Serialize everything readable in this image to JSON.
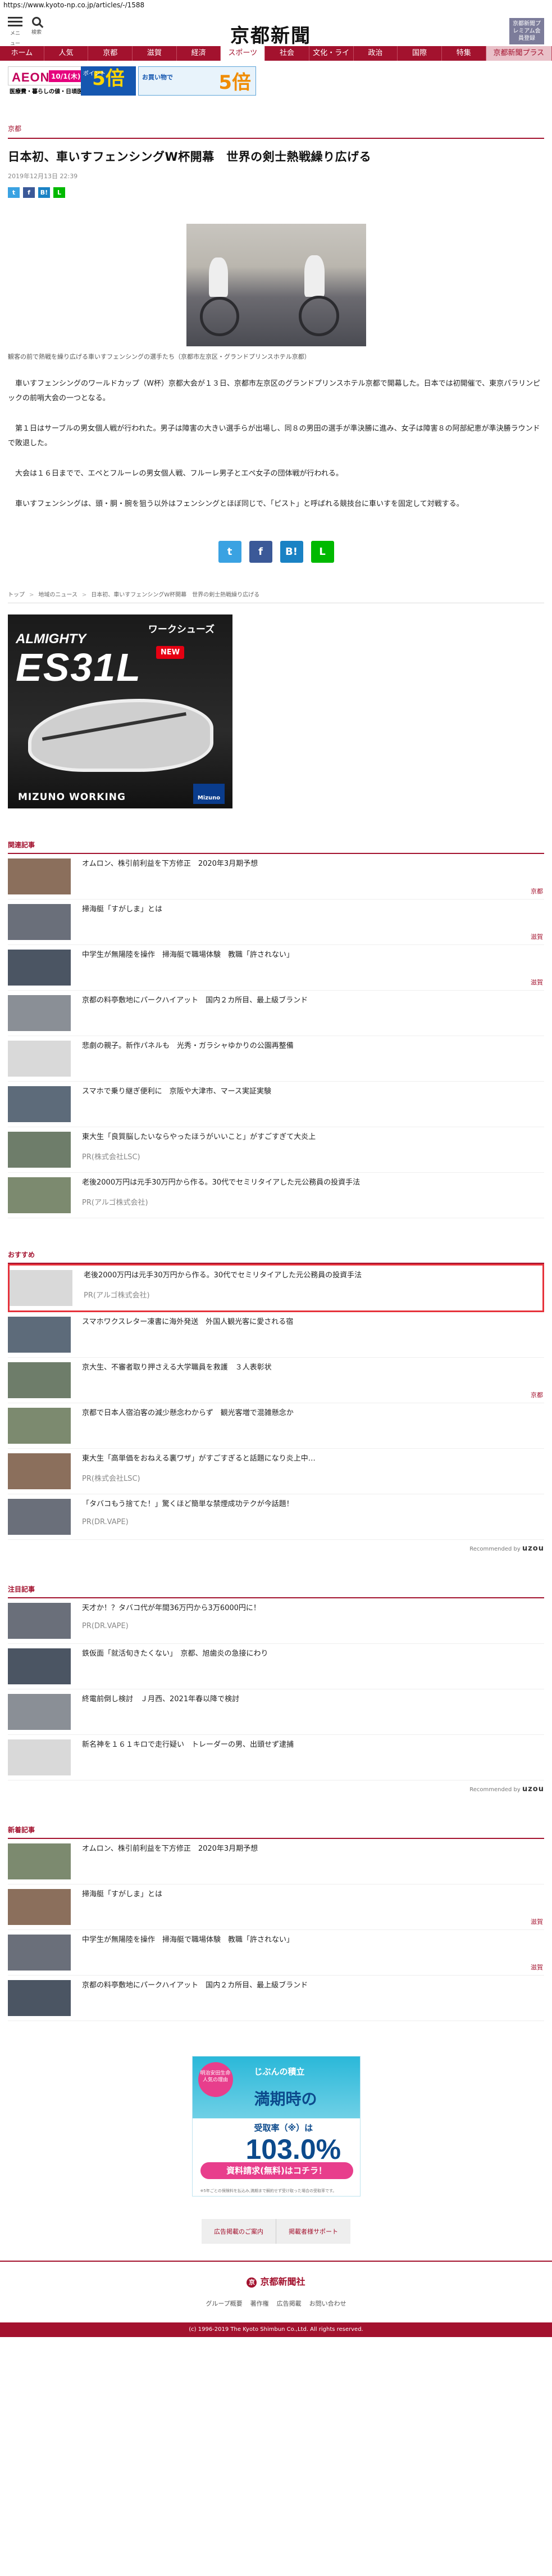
{
  "browser": {
    "url": "https://www.kyoto-np.co.jp/articles/-/1588"
  },
  "header": {
    "menu_label": "メニュー",
    "search_label": "検索",
    "logo": "京都新聞",
    "premium_label": "京都新聞プレミアム会員登録"
  },
  "nav": {
    "items": [
      "ホーム",
      "人気",
      "京都",
      "滋賀",
      "経済",
      "スポーツ",
      "社会",
      "文化・ライフ",
      "政治",
      "国際",
      "特集",
      "京都新聞プラス"
    ],
    "active_index": 5
  },
  "banner": {
    "brand": "AEON",
    "dates": "10/1(木)~10/30(金)",
    "text": "医療費・暮らしの値・日頃医療費が増額",
    "points1": "5倍",
    "points1_note": "ポイント",
    "points2": "5倍",
    "points2_note": "お買い物で"
  },
  "article": {
    "category": "京都",
    "title": "日本初、車いすフェンシングW杯開幕　世界の剣士熱戦繰り広げる",
    "date": "2019年12月13日 22:39",
    "caption": "観客の前で熱戦を繰り広げる車いすフェンシングの選手たち（京都市左京区・グランドプリンスホテル京都）",
    "paragraphs": [
      "車いすフェンシングのワールドカップ（W杯）京都大会が１３日、京都市左京区のグランドプリンスホテル京都で開幕した。日本では初開催で、東京パラリンピックの前哨大会の一つとなる。",
      "第１日はサーブルの男女個人戦が行われた。男子は障害の大きい選手らが出場し、同８の男田の選手が準決勝に進み、女子は障害８の阿部紀恵が準決勝ラウンドで敗退した。",
      "大会は１６日までで、エペとフルーレの男女個人戦、フルーレ男子とエペ女子の団体戦が行われる。",
      "車いすフェンシングは、頭・胴・腕を狙う以外はフェンシングとほぼ同じで、「ピスト」と呼ばれる競技台に車いすを固定して対戦する。"
    ]
  },
  "share": {
    "twitter": "t",
    "facebook": "f",
    "hatena": "B!",
    "line": "L"
  },
  "breadcrumb": [
    "トップ",
    "地域のニュース",
    "日本初、車いすフェンシングW杯開幕　世界の剣士熱戦繰り広げる"
  ],
  "ad1": {
    "series": "ワークシューズ",
    "brand_top": "ALMIGHTY",
    "model": "ES31L",
    "badge": "NEW",
    "footer": "MIZUNO WORKING",
    "maker": "Mizuno"
  },
  "related": {
    "heading": "関連記事",
    "items": [
      {
        "title": "オムロン、株引前利益を下方修正　2020年3月期予想",
        "tag": "京都"
      },
      {
        "title": "掃海艇「すがしま」とは",
        "tag": "滋賀"
      },
      {
        "title": "中学生が無陽陸を操作　掃海艇で職場体験　教職「許されない」",
        "tag": "滋賀"
      },
      {
        "title": "京都の料亭敷地にパークハイアット　国内２カ所目、最上級ブランド",
        "tag": ""
      },
      {
        "title": "悲劇の親子。新作パネルも　光秀・ガラシャゆかりの公園再整備",
        "tag": ""
      },
      {
        "title": "スマホで乗り継ぎ便利に　京阪や大津市、マース実証実験",
        "tag": ""
      },
      {
        "title": "東大生「良質脳したいならやったほうがいいこと」がすごすぎて大炎上",
        "pr": "PR(株式会社LSC)"
      },
      {
        "title": "老後2000万円は元手30万円から作る。30代でセミリタイアした元公務員の投資手法",
        "pr": "PR(アルゴ株式会社)"
      }
    ]
  },
  "recommended": {
    "heading": "おすすめ",
    "items": [
      {
        "title": "老後2000万円は元手30万円から作る。30代でセミリタイアした元公務員の投資手法",
        "pr": "PR(アルゴ株式会社)"
      },
      {
        "title": "スマホワクスレター凍書に海外発送　外国人観光客に愛される宿",
        "tag": ""
      },
      {
        "title": "京大生、不審者取り押さえる大学職員を救護　３人表彰状",
        "tag": "京都"
      },
      {
        "title": "京都で日本人宿泊客の減少懸念わからず　観光客増で混雑懸念か",
        "tag": ""
      },
      {
        "title": "東大生「高単価をおねえる裏ワザ」がすごすぎると話題になり炎上中…",
        "pr": "PR(株式会社LSC)"
      },
      {
        "title": "「タバコもう捨てた！」驚くほど簡単な禁煙成功テクが今話題！",
        "pr": "PR(DR.VAPE)"
      }
    ],
    "powered_by": "Recommended by",
    "powered_brand": "uzou"
  },
  "featured": {
    "heading": "注目記事",
    "items": [
      {
        "title": "天才か！？タバコ代が年間36万円から3万6000円に！",
        "pr": "PR(DR.VAPE)"
      },
      {
        "title": "鉄仮面「就活旬きたくない」　京都、旭歯炎の急接にわり",
        "tag": ""
      },
      {
        "title": "終電前倒し検討　Ｊ月西、2021年春以降で検討",
        "tag": ""
      },
      {
        "title": "新名神を１６１キロで走行疑い　トレーダーの男、出頭せず逮捕",
        "tag": ""
      }
    ],
    "powered_by": "Recommended by",
    "powered_brand": "uzou"
  },
  "latest": {
    "heading": "新着記事",
    "items": [
      {
        "title": "オムロン、株引前利益を下方修正　2020年3月期予想",
        "tag": ""
      },
      {
        "title": "掃海艇「すがしま」とは",
        "tag": "滋賀"
      },
      {
        "title": "中学生が無陽陸を操作　掃海艇で職場体験　教職「許されない」",
        "tag": "滋賀"
      },
      {
        "title": "京都の料亭敷地にパークハイアット　国内２カ所目、最上級ブランド",
        "tag": ""
      }
    ]
  },
  "ad2": {
    "badge": "明治安田生命 人気の理由",
    "product": "じぶんの積立",
    "line1": "満期時の",
    "line2": "受取率",
    "line2_note": "（※）は",
    "rate": "103.0%",
    "cta": "資料請求(無料)はコチラ！",
    "fine": "※5年ごとの保険料を払込み,満期まで解約せず受け取った場合の受取率です。"
  },
  "ad_links": [
    "広告掲載のご案内",
    "掲載者様サポート"
  ],
  "footer": {
    "logo_mark": "京",
    "logo": "京都新聞社",
    "links": [
      "グループ概要",
      "著作権",
      "広告掲載",
      "お問い合わせ"
    ],
    "copyright": "(c) 1996-2019 The Kyoto Shimbun Co.,Ltd. All rights reserved."
  }
}
